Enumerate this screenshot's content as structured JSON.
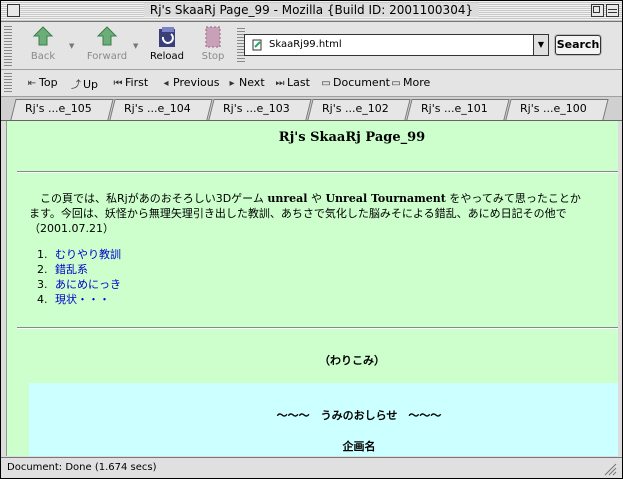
{
  "window": {
    "title": "Rj's SkaaRj Page_99 - Mozilla {Build ID: 2001100304}"
  },
  "toolbar": {
    "back": "Back",
    "forward": "Forward",
    "reload": "Reload",
    "stop": "Stop",
    "url": "SkaaRj99.html",
    "search": "Search"
  },
  "personal_toolbar": {
    "top": "Top",
    "up": "Up",
    "first": "First",
    "previous": "Previous",
    "next": "Next",
    "last": "Last",
    "document": "Document",
    "more": "More"
  },
  "tabs": [
    "Rj's ...e_105",
    "Rj's ...e_104",
    "Rj's ...e_103",
    "Rj's ...e_102",
    "Rj's ...e_101",
    "Rj's ...e_100"
  ],
  "page": {
    "title": "Rj's SkaaRj Page_99",
    "intro_a": "　この頁では、私Rjがあのおそろしい3Dゲーム ",
    "intro_b": "unreal",
    "intro_c": " や ",
    "intro_d": "Unreal Tournament",
    "intro_e": " をやってみて思ったことか",
    "intro_line2": "ます。今回は、妖怪から無理矢理引き出した教訓、あちさで気化した脳みそによる錯乱、あにめ日記その他で",
    "intro_date": "（2001.07.21）",
    "list": [
      {
        "num": "1.",
        "text": "むりやり教訓"
      },
      {
        "num": "2.",
        "text": "錯乱系"
      },
      {
        "num": "3.",
        "text": "あにめにっき"
      },
      {
        "num": "4.",
        "text": "現状・・・"
      }
    ],
    "warikomi": "（わりこみ）",
    "notice_title": "～～～　うみのおしらせ　～～～",
    "notice_sub": "企画名"
  },
  "status": {
    "text": "Document: Done (1.674 secs)"
  },
  "colors": {
    "page_bg": "#ccffcc",
    "box_bg": "#ccffff",
    "link": "#0000cc"
  }
}
